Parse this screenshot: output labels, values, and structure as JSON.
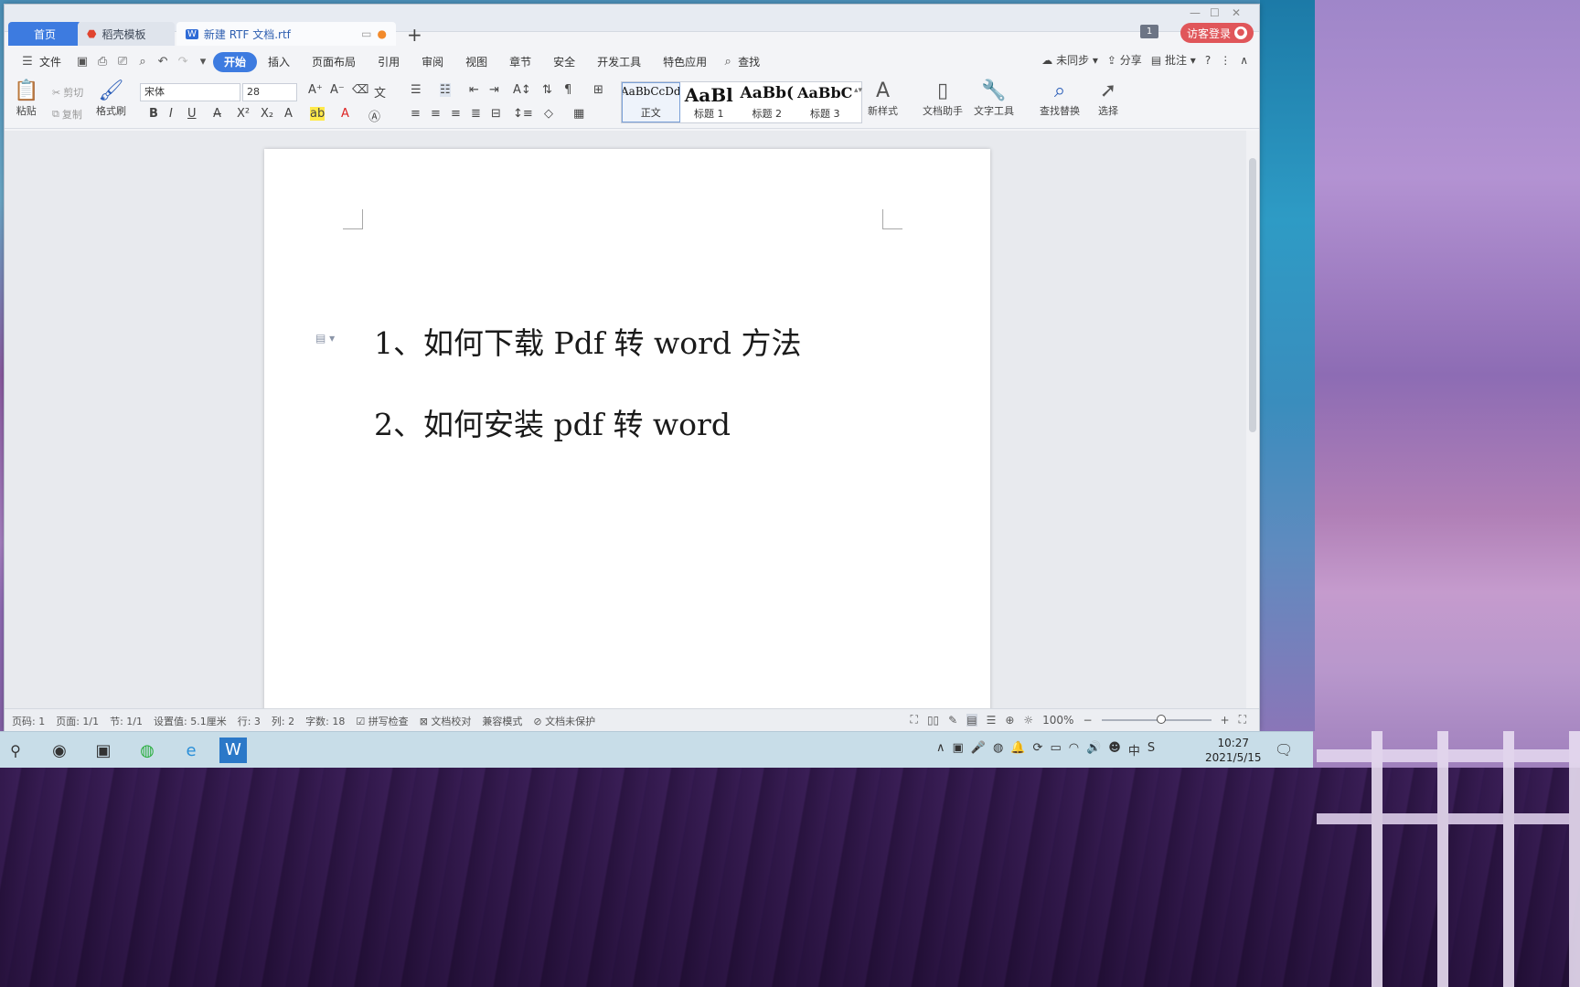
{
  "window": {
    "tabs": [
      {
        "label": "首页"
      },
      {
        "label": "稻壳模板"
      },
      {
        "label": "新建 RTF 文档.rtf"
      }
    ],
    "window_badge": "1",
    "login_label": "访客登录"
  },
  "ribbon_tabs": [
    "文件",
    "开始",
    "插入",
    "页面布局",
    "引用",
    "审阅",
    "视图",
    "章节",
    "安全",
    "开发工具",
    "特色应用",
    "查找"
  ],
  "ribbon_right": {
    "sync": "未同步",
    "share": "分享",
    "annotate": "批注"
  },
  "ribbon": {
    "paste": "粘贴",
    "cut": "剪切",
    "copy": "复制",
    "format_painter": "格式刷",
    "font_name": "宋体",
    "font_size": "28",
    "styles": [
      {
        "sample": "AaBbCcDd",
        "name": "正文"
      },
      {
        "sample": "AaBl",
        "name": "标题 1"
      },
      {
        "sample": "AaBb(",
        "name": "标题 2"
      },
      {
        "sample": "AaBbC",
        "name": "标题 3"
      }
    ],
    "new_style": "新样式",
    "doc_assistant": "文档助手",
    "text_tools": "文字工具",
    "find_replace": "查找替换",
    "select": "选择"
  },
  "document": {
    "lines": [
      "1、如何下载 Pdf 转 word 方法",
      "2、如何安装 pdf 转 word"
    ]
  },
  "statusbar": {
    "page_code": "页码: 1",
    "page": "页面: 1/1",
    "section": "节: 1/1",
    "setting": "设置值: 5.1厘米",
    "row": "行: 3",
    "col": "列: 2",
    "word_count": "字数: 18",
    "spell_check": "拼写检查",
    "doc_proof": "文档校对",
    "compat": "兼容模式",
    "protect": "文档未保护",
    "zoom": "100%"
  },
  "taskbar": {
    "time": "10:27",
    "date": "2021/5/15"
  }
}
